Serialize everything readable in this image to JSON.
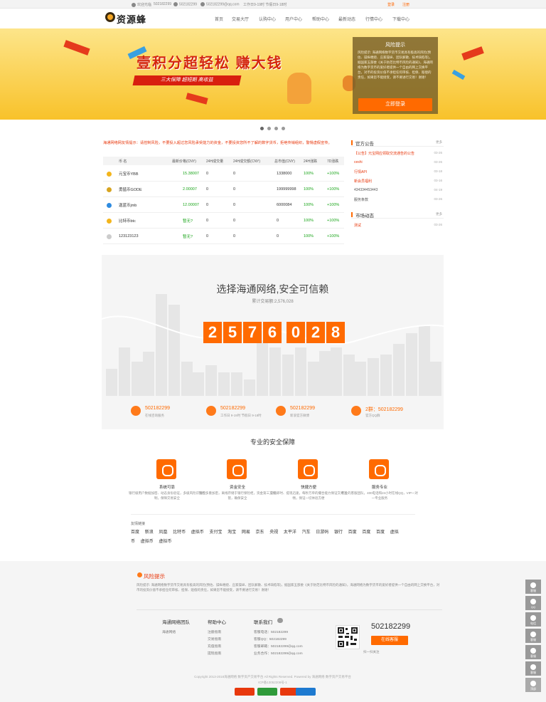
{
  "topbar": {
    "welcome": "欢迎光临",
    "phone1": "502182299",
    "phone2": "502182299",
    "email": "502182299@qq.com",
    "hours": "工作日9-19时 节假日9-18时",
    "login": "登录",
    "register": "注册"
  },
  "header": {
    "logo_text": "资源蜂",
    "nav": [
      "首页",
      "交易大厅",
      "认购中心",
      "用户中心",
      "帮助中心",
      "最新动态",
      "行情中心",
      "下载中心"
    ]
  },
  "banner": {
    "main_text": "壹积分超轻松 赚大钱",
    "sub_text": "三大保障 超短期 高收益",
    "risk_title": "风险提示",
    "risk_text": "风险提示: 海通网络数字货币交易具有极高的风险(预估、操纵缠绕、庄家操纵、团队解散、技术缺陷等)，据国家五部委《关于防范比特币风险的通知》，海通网络为数字货币的爱好者提供一个自由的网上交换平台，对币的投资价值不承担任何审核、担保、赔偿的责任，如果您不能接受，请不要进行交易！谢谢！",
    "login_button": "立即登录",
    "slide_count": 4,
    "active_slide": 0,
    "colors": {
      "banner_top": "#fde58a",
      "banner_bottom": "#f8c22a",
      "accent": "#ff6a00"
    }
  },
  "market": {
    "notice": "海通网络网友情提示：请控制风险，不要投入超过您风险承受能力的资金，不要投资您所不了解的数字货币，拒绝传销组织，警惕虚假宣传。",
    "headers": [
      "币 名",
      "最新价格(CNY)",
      "24H成交量",
      "24H成交额(CNY)",
      "总市值(CNY)",
      "24H涨跌",
      "7D涨跌"
    ],
    "rows": [
      {
        "name": "元宝币YBB",
        "price": "15.38007",
        "vol": "0",
        "amount": "0",
        "cap": "1338000",
        "d1": "100%",
        "d7": "+100%"
      },
      {
        "name": "勇猛币GODE",
        "price": "2.00007",
        "vol": "0",
        "amount": "0",
        "cap": "199999998",
        "d1": "100%",
        "d7": "+100%"
      },
      {
        "name": "迦蓝币jmb",
        "price": "12.00007",
        "vol": "0",
        "amount": "0",
        "cap": "6000084",
        "d1": "100%",
        "d7": "+100%"
      },
      {
        "name": "比特币btc",
        "price": "暂无?",
        "vol": "0",
        "amount": "0",
        "cap": "0",
        "d1": "100%",
        "d7": "+100%"
      },
      {
        "name": "123123123",
        "price": "暂无?",
        "vol": "0",
        "amount": "0",
        "cap": "0",
        "d1": "100%",
        "d7": "+100%"
      }
    ]
  },
  "announcements": {
    "title": "官方公告",
    "more": "更多",
    "items": [
      {
        "text": "【公告】元宝网应领取交流通告的公告",
        "date": "03-26",
        "red": true
      },
      {
        "text": "ceshi",
        "date": "03-26",
        "red": true
      },
      {
        "text": "行情API",
        "date": "03-18",
        "red": true
      },
      {
        "text": "新会员福利",
        "date": "03-16",
        "red": true
      },
      {
        "text": "434334453443",
        "date": "04-19",
        "red": false
      },
      {
        "text": "服务条款",
        "date": "03-26",
        "red": false
      }
    ]
  },
  "market_news": {
    "title": "市场动态",
    "more": "更多",
    "items": [
      {
        "text": "测试",
        "date": "03-26"
      }
    ]
  },
  "stats": {
    "title": "选择海通网络,安全可信赖",
    "subtitle": "累计交易额:2,576,028",
    "digits": [
      "2",
      "5",
      "7",
      "6",
      "0",
      "2",
      "8"
    ]
  },
  "contacts": [
    {
      "num": "502182299",
      "sub": "在线咨询服务"
    },
    {
      "num": "502182299",
      "sub": "工作日 9-19时 节假日 9-18时"
    },
    {
      "num": "502182299",
      "sub": "新浪官方微博"
    },
    {
      "num": "2群：502182299",
      "sub": "官方QQ群"
    }
  ],
  "security": {
    "title": "专业的安全保障",
    "features": [
      {
        "name": "系统可靠",
        "desc": "银行级用户数据加密、动态身份验证，多级风险识别控制，保障交易安全"
      },
      {
        "name": "资金安全",
        "desc": "钱包多重加密，离线存储于银行保险柜，资金第三方托管，确保安全"
      },
      {
        "name": "快捷方便",
        "desc": "充值即时、提现迅速，每秒万单的撮合能力保证交易流畅，保证一切体验方便"
      },
      {
        "name": "服务专业",
        "desc": "专业的客服团队，400电话和24小时在线QQ，VIP一对一专业服务"
      }
    ]
  },
  "friend_links": {
    "label": "友情链接",
    "items": [
      "百度",
      "新浪",
      "凤凰",
      "比特币",
      "虚拟币",
      "支付宝",
      "淘宝",
      "网易",
      "京东",
      "央视",
      "太平洋",
      "汽车",
      "日游码",
      "银行",
      "百度",
      "百度",
      "百度",
      "虚拟币",
      "虚拟币",
      "虚拟币"
    ]
  },
  "footer": {
    "risk_title": "风险提示",
    "risk_text": "风险提示: 海通网络数字货币交易具有极高的风险(预估、操纵缠绕、庄家操纵、团队解散、技术缺陷等)，据国家五部委《关于防范比特币风险的通知》，海通网络为数字货币的爱好者提供一个自由的网上交换平台，对币的投资价值不承担任何审核、担保、赔偿的责任，如果您不能接受，请不要进行交易！谢谢！",
    "col1_title": "海通网络团队",
    "col1_links": [
      "海通网络"
    ],
    "col2_title": "帮助中心",
    "col2_links": [
      "注册指南",
      "交易指南",
      "充值指南",
      "提现指南"
    ],
    "col3_title": "联系我们",
    "col3_links": [
      "客服电话：502182299",
      "客服QQ：502182299",
      "客服邮箱：502182299@qq.com",
      "业务合作：502182299@qq.com"
    ],
    "phone": "502182299",
    "online_cs": "在线客服",
    "qr_caption": "扫一扫关注",
    "copyright": "Copyright 2013-2018海通网络 数字资产交易平台 All Rights Reserved. Powered by 海通网络 数字资产交易平台",
    "icp": "ICP备13052208号-1"
  },
  "float_bar": [
    "客服",
    "QQ",
    "电话",
    "客服",
    "客服",
    "客服",
    "顶部"
  ]
}
